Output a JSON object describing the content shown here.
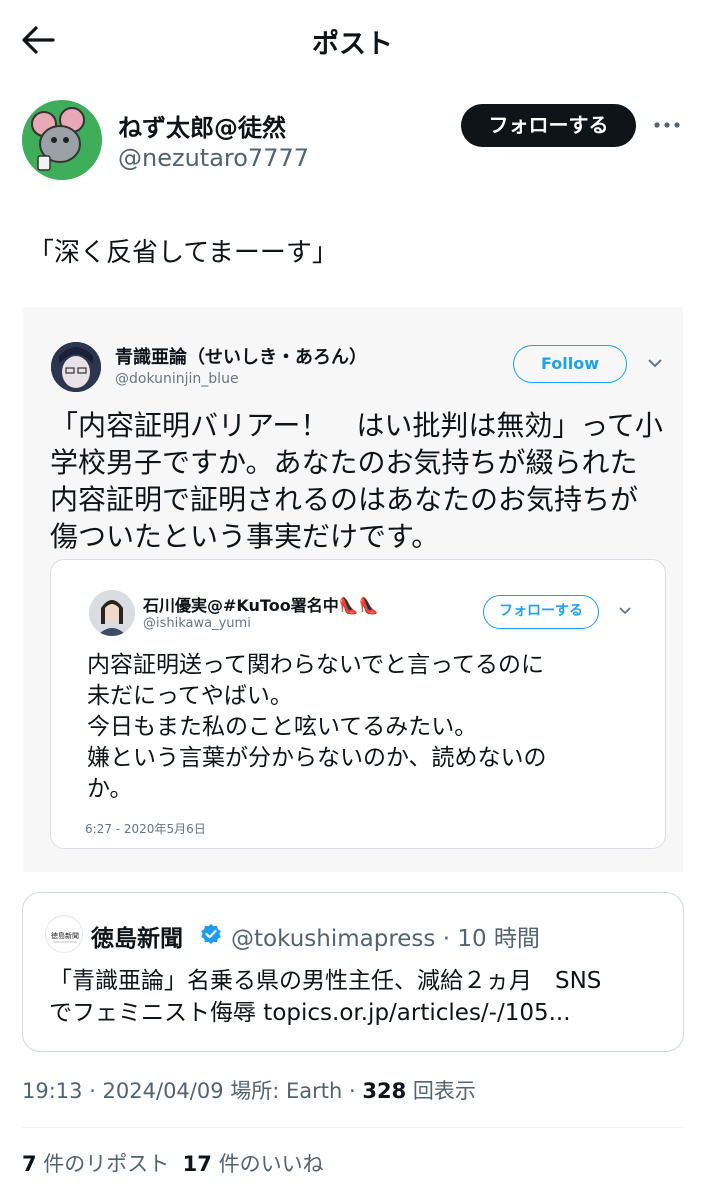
{
  "header": {
    "title": "ポスト"
  },
  "author": {
    "display_name": "ねず太郎@徒然",
    "handle": "@nezutaro7777",
    "follow_label": "フォローする"
  },
  "tweet": {
    "text": "「深く反省してまーーす」"
  },
  "screenshot": {
    "name": "青識亜論（せいしき・あろん）",
    "handle": "@dokuninjin_blue",
    "follow_label": "Follow",
    "text": "「内容証明バリアー！　はい批判は無効」って小学校男子ですか。あなたのお気持ちが綴られた内容証明で証明されるのはあなたのお気持ちが傷ついたという事実だけです。",
    "inner": {
      "name": "石川優実@#KuToo署名中👠👠",
      "handle": "@ishikawa_yumi",
      "follow_label": "フォローする",
      "line1": "内容証明送って関わらないでと言ってるのに",
      "line2": "未だにってやばい。",
      "line3": "今日もまた私のこと呟いてるみたい。",
      "line4": "嫌という言葉が分からないのか、読めないの",
      "line5": "か。",
      "time": "6:27 - 2020年5月6日"
    }
  },
  "quote": {
    "name": "徳島新聞",
    "handle": "@tokushimapress · 10 時間",
    "line1": "「青識亜論」名乗る県の男性主任、減給２ヵ月　SNS",
    "line2": "でフェミニスト侮辱 topics.or.jp/articles/-/105...",
    "logo_text": "徳島新聞"
  },
  "meta": {
    "time_date": "19:13 · 2024/04/09 場所: Earth · ",
    "views_count": "328",
    "views_label": " 回表示"
  },
  "stats": {
    "reposts_count": "7",
    "reposts_label": " 件のリポスト",
    "likes_count": "17",
    "likes_label": " 件のいいね"
  },
  "colors": {
    "accent": "#1da1f2",
    "verified": "#1d9bf0"
  }
}
